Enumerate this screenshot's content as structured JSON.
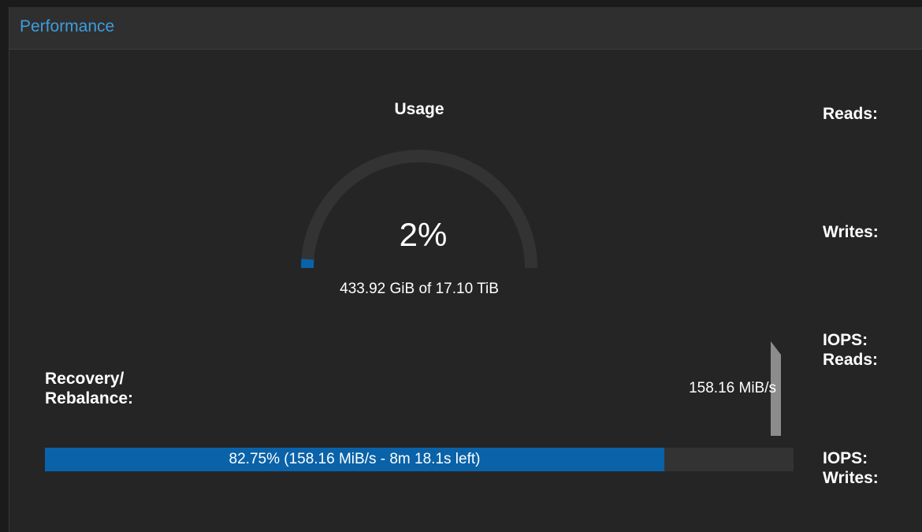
{
  "panel": {
    "title": "Performance"
  },
  "usage": {
    "title": "Usage",
    "percent_label": "2%",
    "percent": 2.48,
    "detail": "433.92 GiB of 17.10 TiB",
    "fill_color": "#0a62a8",
    "track_color": "#333333"
  },
  "recovery": {
    "label_line1": "Recovery/",
    "label_line2": "Rebalance:",
    "rate": "158.16 MiB/s",
    "progress_text": "82.75% (158.16 MiB/s - 8m 18.1s left)",
    "progress_percent": 82.75,
    "fill_color": "#0a62a8"
  },
  "stats": {
    "reads": "Reads:",
    "writes": "Writes:",
    "iops_reads_line1": "IOPS:",
    "iops_reads_line2": "Reads:",
    "iops_writes_line1": "IOPS:",
    "iops_writes_line2": "Writes:"
  }
}
